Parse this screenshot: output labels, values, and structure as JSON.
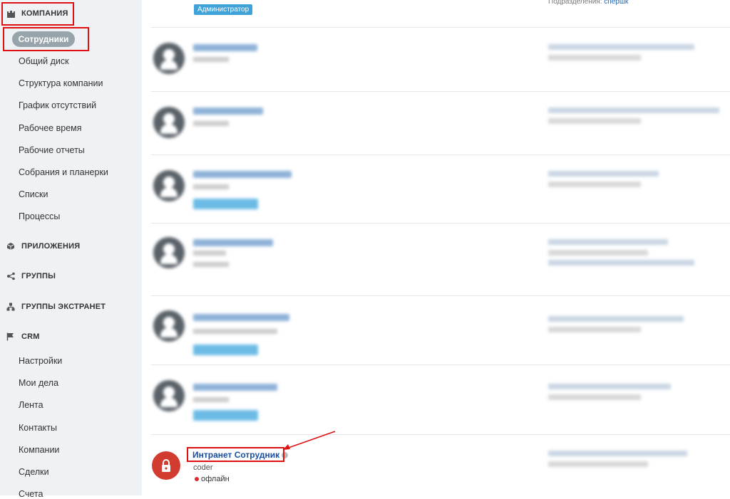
{
  "sidebar": {
    "company_label": "КОМПАНИЯ",
    "active_item": "Сотрудники",
    "company_items": [
      "Общий диск",
      "Структура компании",
      "График отсутствий",
      "Рабочее время",
      "Рабочие отчеты",
      "Собрания и планерки",
      "Списки",
      "Процессы"
    ],
    "apps_label": "ПРИЛОЖЕНИЯ",
    "groups_label": "ГРУППЫ",
    "extranet_label": "ГРУППЫ ЭКСТРАНЕТ",
    "crm_label": "CRM",
    "crm_items": [
      "Настройки",
      "Мои дела",
      "Лента",
      "Контакты",
      "Компании",
      "Сделки",
      "Счета"
    ]
  },
  "top_row": {
    "admin_badge": "Администратор",
    "dept_label": "Подразделения:",
    "dept_value": "спершк"
  },
  "highlight_employee": {
    "name": "Интранет Сотрудник",
    "role": "coder",
    "status": "офлайн"
  },
  "colors": {
    "accent": "#3fa2d8",
    "link": "#2067b0",
    "highlight": "#e01010",
    "avatar_red": "#d23b30"
  }
}
